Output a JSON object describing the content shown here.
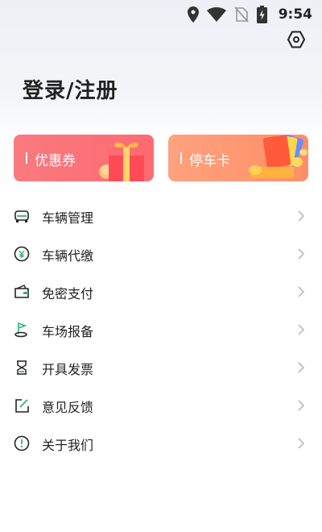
{
  "status_bar": {
    "time": "9:54",
    "icons": [
      "location-icon",
      "wifi-icon",
      "no-sim-icon",
      "battery-charging-icon"
    ]
  },
  "header": {
    "login_label": "登录/注册",
    "settings_icon": "settings-hexagon-icon"
  },
  "cards": {
    "coupon_label": "优惠券",
    "parking_card_label": "停车卡"
  },
  "menu": {
    "items": [
      {
        "label": "车辆管理",
        "icon": "car-icon"
      },
      {
        "label": "车辆代缴",
        "icon": "yuan-coin-icon"
      },
      {
        "label": "免密支付",
        "icon": "wallet-icon"
      },
      {
        "label": "车场报备",
        "icon": "flag-location-icon"
      },
      {
        "label": "开具发票",
        "icon": "invoice-icon"
      },
      {
        "label": "意见反馈",
        "icon": "feedback-edit-icon"
      },
      {
        "label": "关于我们",
        "icon": "info-exclamation-icon"
      }
    ]
  },
  "colors": {
    "accent_green": "#2db57a",
    "coupon_card": "#ff6f75",
    "parking_card": "#ff976f",
    "text": "#222222",
    "chevron": "#bbbbbb"
  }
}
